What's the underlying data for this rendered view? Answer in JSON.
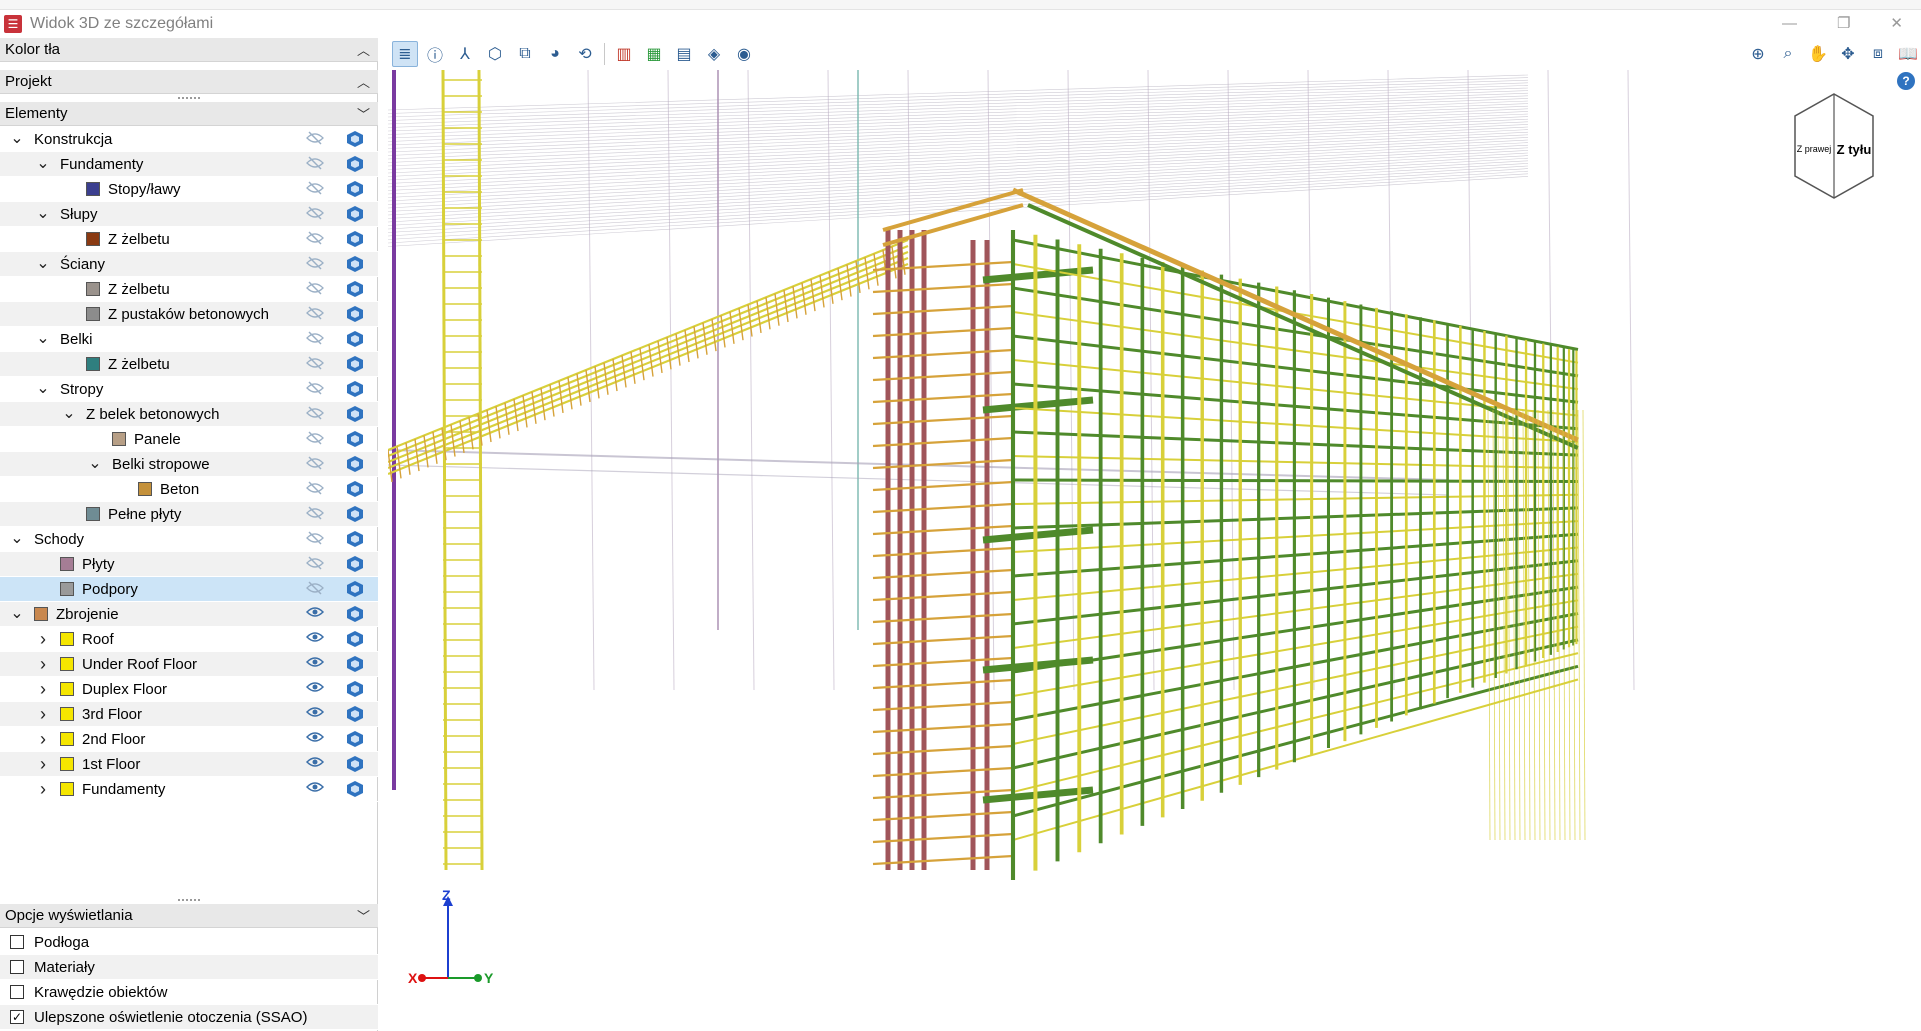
{
  "window": {
    "title": "Widok 3D ze szczegółami",
    "minimize": "—",
    "restore": "❐",
    "close": "✕"
  },
  "panel": {
    "background_header": "Kolor tła",
    "project_header": "Projekt",
    "elements_header": "Elementy",
    "options_header": "Opcje wyświetlania"
  },
  "tree": [
    {
      "label": "Konstrukcja",
      "level": 0,
      "expander": "down",
      "swatch": null,
      "visible": false
    },
    {
      "label": "Fundamenty",
      "level": 1,
      "expander": "down",
      "swatch": null,
      "visible": false
    },
    {
      "label": "Stopy/ławy",
      "level": 2,
      "expander": null,
      "swatch": "#3b3f8f",
      "visible": false
    },
    {
      "label": "Słupy",
      "level": 1,
      "expander": "down",
      "swatch": null,
      "visible": false
    },
    {
      "label": "Z żelbetu",
      "level": 2,
      "expander": null,
      "swatch": "#8a3a12",
      "visible": false
    },
    {
      "label": "Ściany",
      "level": 1,
      "expander": "down",
      "swatch": null,
      "visible": false
    },
    {
      "label": "Z żelbetu",
      "level": 2,
      "expander": null,
      "swatch": "#9a928c",
      "visible": false
    },
    {
      "label": "Z pustaków betonowych",
      "level": 2,
      "expander": null,
      "swatch": "#8c8c8c",
      "visible": false
    },
    {
      "label": "Belki",
      "level": 1,
      "expander": "down",
      "swatch": null,
      "visible": false
    },
    {
      "label": "Z żelbetu",
      "level": 2,
      "expander": null,
      "swatch": "#2f7f7f",
      "visible": false
    },
    {
      "label": "Stropy",
      "level": 1,
      "expander": "down",
      "swatch": null,
      "visible": false
    },
    {
      "label": "Z belek betonowych",
      "level": 2,
      "expander": "down",
      "swatch": null,
      "visible": false
    },
    {
      "label": "Panele",
      "level": 3,
      "expander": null,
      "swatch": "#b79f86",
      "visible": false
    },
    {
      "label": "Belki stropowe",
      "level": 3,
      "expander": "down",
      "swatch": null,
      "visible": false
    },
    {
      "label": "Beton",
      "level": 4,
      "expander": null,
      "swatch": "#c4913b",
      "visible": false
    },
    {
      "label": "Pełne płyty",
      "level": 2,
      "expander": null,
      "swatch": "#6f8c94",
      "visible": false
    },
    {
      "label": "Schody",
      "level": 0,
      "expander": "down",
      "swatch": null,
      "visible": false
    },
    {
      "label": "Płyty",
      "level": 1,
      "expander": null,
      "swatch": "#a57d95",
      "visible": false
    },
    {
      "label": "Podpory",
      "level": 1,
      "expander": null,
      "swatch": "#9a9a9a",
      "visible": false,
      "selected": true
    },
    {
      "label": "Zbrojenie",
      "level": 0,
      "expander": "down",
      "swatch": "#c9884f",
      "visible": true
    },
    {
      "label": "Roof",
      "level": 1,
      "expander": "right",
      "swatch": "#f5e600",
      "visible": true
    },
    {
      "label": "Under Roof Floor",
      "level": 1,
      "expander": "right",
      "swatch": "#f5e600",
      "visible": true
    },
    {
      "label": "Duplex Floor",
      "level": 1,
      "expander": "right",
      "swatch": "#f5e600",
      "visible": true
    },
    {
      "label": "3rd Floor",
      "level": 1,
      "expander": "right",
      "swatch": "#f5e600",
      "visible": true
    },
    {
      "label": "2nd Floor",
      "level": 1,
      "expander": "right",
      "swatch": "#f5e600",
      "visible": true
    },
    {
      "label": "1st Floor",
      "level": 1,
      "expander": "right",
      "swatch": "#f5e600",
      "visible": true
    },
    {
      "label": "Fundamenty",
      "level": 1,
      "expander": "right",
      "swatch": "#f5e600",
      "visible": true
    }
  ],
  "options": [
    {
      "label": "Podłoga",
      "checked": false
    },
    {
      "label": "Materiały",
      "checked": false
    },
    {
      "label": "Krawędzie obiektów",
      "checked": false
    },
    {
      "label": "Ulepszone oświetlenie otoczenia (SSAO)",
      "checked": true
    }
  ],
  "toolbar": {
    "left_tools": [
      "layers-icon",
      "info-icon",
      "axes-icon",
      "box-view-icon",
      "multi-box-icon",
      "render-icon",
      "orbit-icon",
      "section-red-icon",
      "section-green-icon",
      "grid-plane-icon",
      "stack-icon",
      "eye-icon"
    ],
    "right_tools": [
      "zoom-all-icon",
      "zoom-window-icon",
      "pan-hand-icon",
      "move-icon",
      "view-toggle-icon",
      "book-icon"
    ],
    "help": "?"
  },
  "navcube": {
    "face_left": "Z prawej",
    "face_right": "Z tyłu"
  },
  "axes": {
    "x": "X",
    "y": "Y",
    "z": "Z"
  },
  "colors": {
    "rebar_yellow": "#d8d03a",
    "rebar_green": "#4f8a2b",
    "rebar_red": "#a0555a",
    "rebar_orange": "#d6a23a",
    "selection": "#cce4f7"
  }
}
